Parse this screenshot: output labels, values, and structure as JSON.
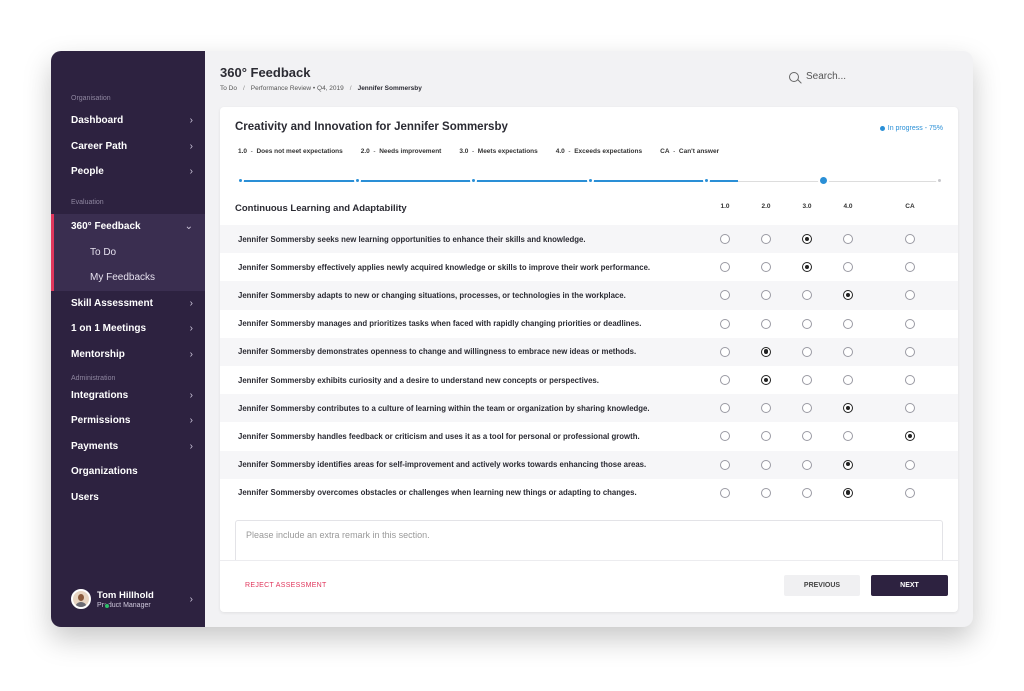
{
  "sidebar": {
    "section_org": "Organisation",
    "dashboard": "Dashboard",
    "career_path": "Career Path",
    "people": "People",
    "section_eval": "Evaluation",
    "feedback360": "360° Feedback",
    "todo": "To Do",
    "my_feedbacks": "My Feedbacks",
    "skill_assessment": "Skill Assessment",
    "one_on_one": "1 on 1 Meetings",
    "mentorship": "Mentorship",
    "section_admin": "Administration",
    "integrations": "Integrations",
    "permissions": "Permissions",
    "payments": "Payments",
    "organizations": "Organizations",
    "users": "Users",
    "user_name": "Tom Hillhold",
    "user_role": "Product Manager",
    "chevron": "›",
    "chevron_down": "⌄"
  },
  "header": {
    "title": "360° Feedback",
    "crumb1": "To Do",
    "crumb2": "Performance Review  •  Q4, 2019",
    "crumb3": "Jennifer Sommersby",
    "sep": "/",
    "search_placeholder": "Search..."
  },
  "card": {
    "title": "Creativity and Innovation for Jennifer Sommersby",
    "status": "In progress - 75%",
    "progress": 0.75,
    "scale": [
      {
        "code": "1.0",
        "label": "Does not meet expectations"
      },
      {
        "code": "2.0",
        "label": "Needs improvement"
      },
      {
        "code": "3.0",
        "label": "Meets expectations"
      },
      {
        "code": "4.0",
        "label": "Exceeds expectations"
      },
      {
        "code": "CA",
        "label": "Can't answer"
      }
    ],
    "section_title": "Continuous Learning and Adaptability",
    "columns": [
      "1.0",
      "2.0",
      "3.0",
      "4.0",
      "CA"
    ],
    "questions": [
      {
        "text": "Jennifer Sommersby seeks new learning opportunities to enhance their skills and knowledge.",
        "selected": "3.0"
      },
      {
        "text": "Jennifer Sommersby effectively applies newly acquired knowledge or skills to improve their work performance.",
        "selected": "3.0"
      },
      {
        "text": "Jennifer Sommersby adapts to new or changing situations, processes, or technologies in the workplace.",
        "selected": "4.0"
      },
      {
        "text": "Jennifer Sommersby manages and prioritizes tasks when faced with rapidly changing priorities or deadlines.",
        "selected": ""
      },
      {
        "text": "Jennifer Sommersby demonstrates openness to change and willingness to embrace new ideas or methods.",
        "selected": "2.0"
      },
      {
        "text": "Jennifer Sommersby exhibits curiosity and a desire to understand new concepts or perspectives.",
        "selected": "2.0"
      },
      {
        "text": "Jennifer Sommersby contributes to a culture of learning within the team or organization by sharing knowledge.",
        "selected": "4.0"
      },
      {
        "text": "Jennifer Sommersby handles feedback or criticism and uses it as a tool for personal or professional growth.",
        "selected": "CA"
      },
      {
        "text": "Jennifer Sommersby identifies areas for self-improvement and actively works towards enhancing those areas.",
        "selected": "4.0"
      },
      {
        "text": "Jennifer Sommersby overcomes obstacles or challenges when learning new things or adapting to changes.",
        "selected": "4.0"
      }
    ],
    "remark_placeholder": "Please include an extra remark in this section.",
    "reject_label": "REJECT ASSESSMENT",
    "previous_label": "PREVIOUS",
    "next_label": "NEXT"
  },
  "colors": {
    "sidebar_bg": "#2d2240",
    "accent_blue": "#2a8fd6",
    "accent_red": "#e0365c"
  }
}
